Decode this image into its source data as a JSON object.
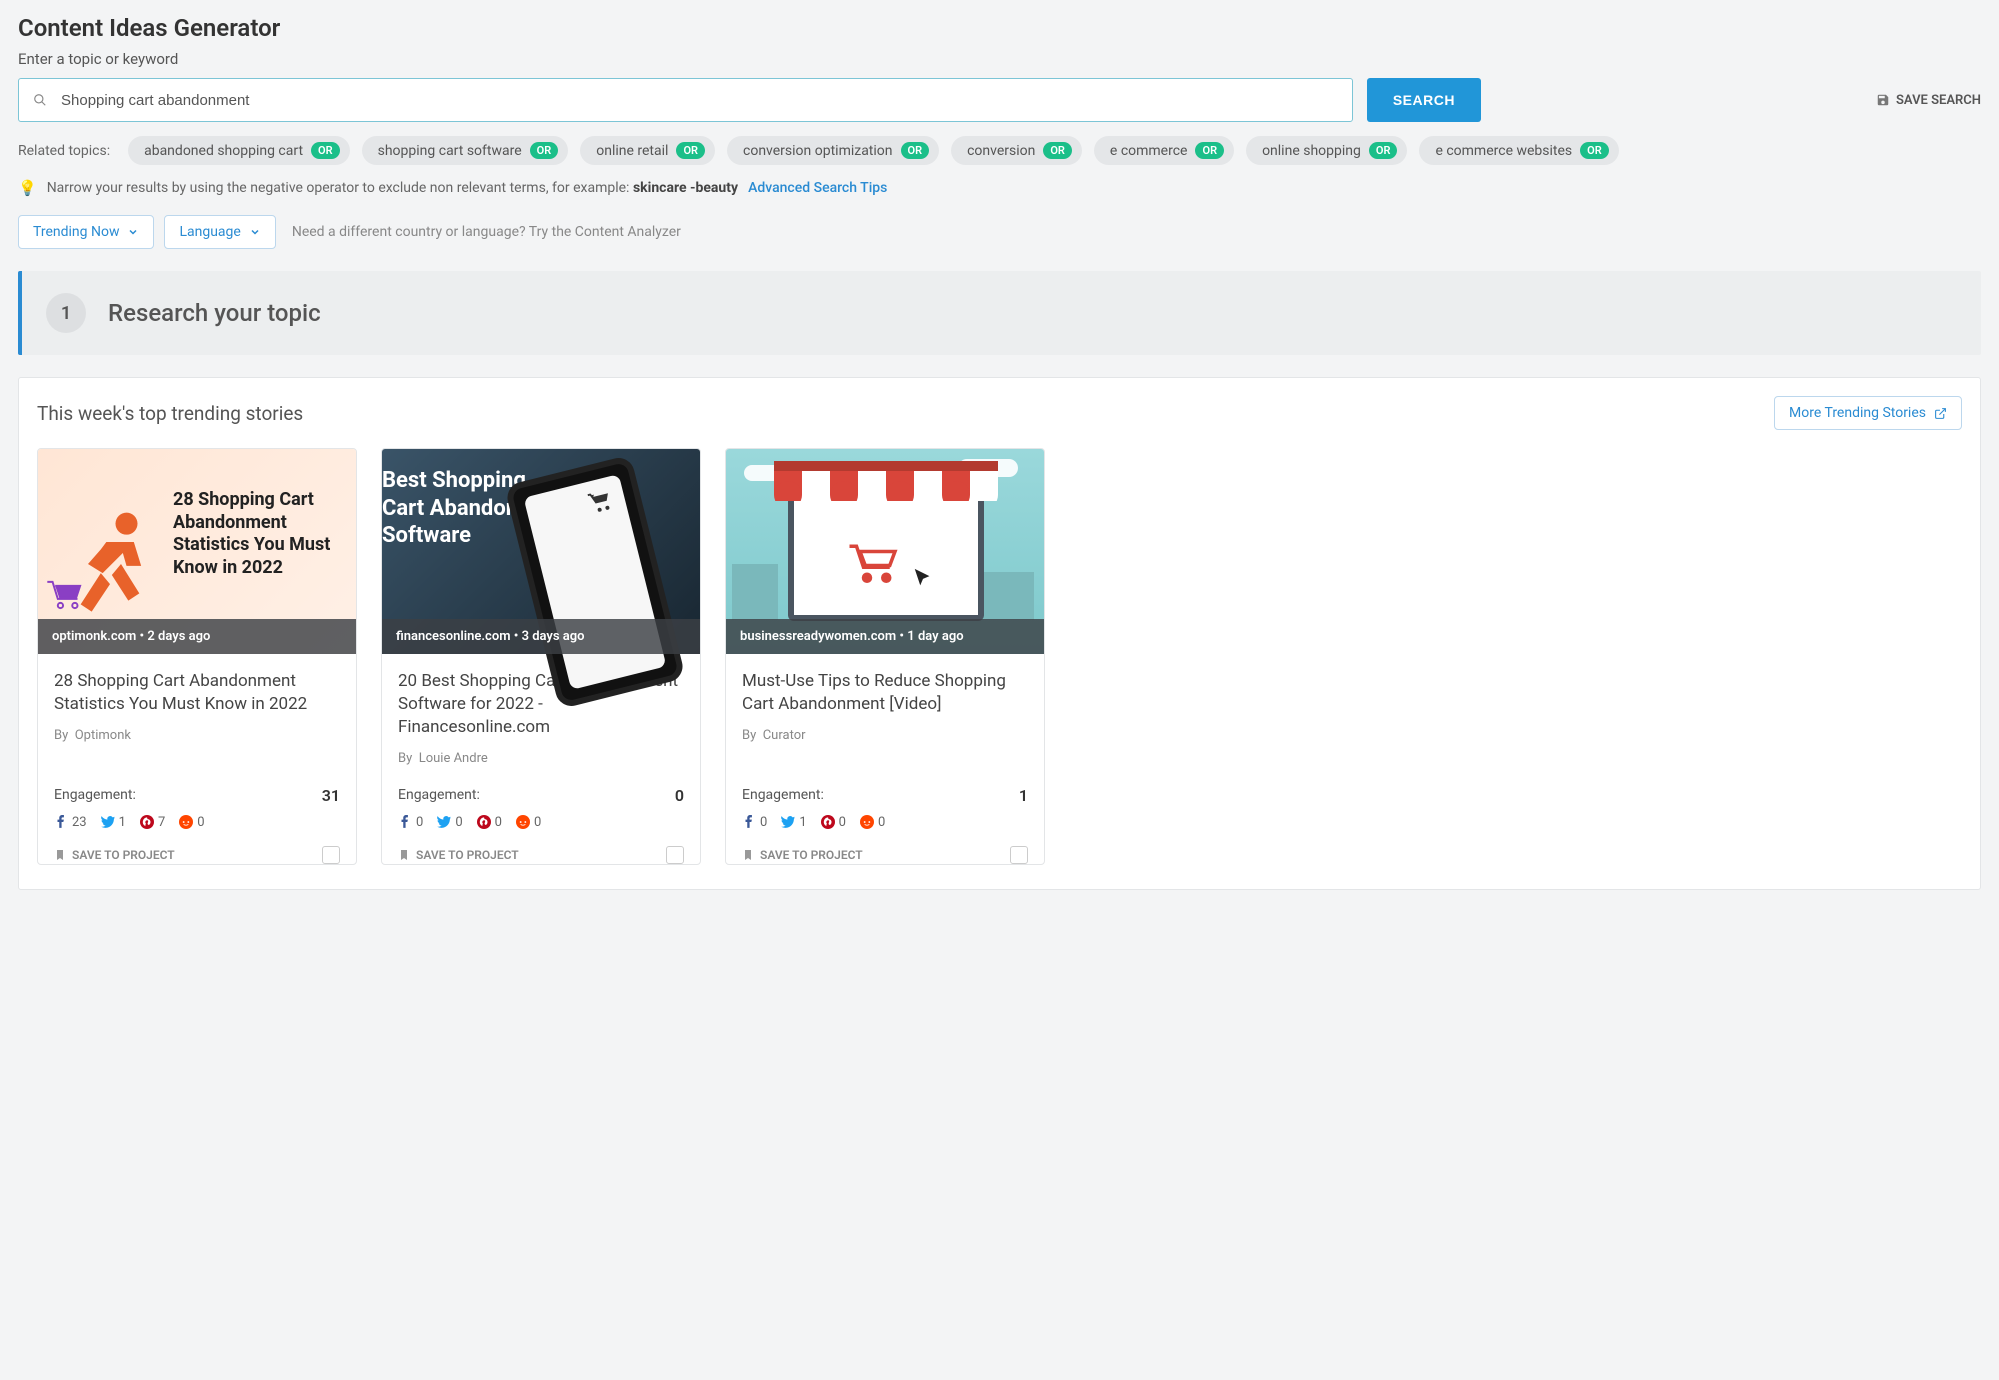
{
  "header": {
    "title": "Content Ideas Generator",
    "subtitle": "Enter a topic or keyword",
    "search_value": "Shopping cart abandonment",
    "search_button": "SEARCH",
    "save_search": "SAVE SEARCH"
  },
  "related": {
    "label": "Related topics:",
    "or": "OR",
    "items": [
      "abandoned shopping cart",
      "shopping cart software",
      "online retail",
      "conversion optimization",
      "conversion",
      "e commerce",
      "online shopping",
      "e commerce websites"
    ]
  },
  "tip": {
    "text": "Narrow your results by using the negative operator to exclude non relevant terms, for example: ",
    "example": "skincare -beauty",
    "link": "Advanced Search Tips"
  },
  "filters": {
    "trending": "Trending Now",
    "language": "Language",
    "hint": "Need a different country or language? Try the Content Analyzer"
  },
  "section": {
    "num": "1",
    "title": "Research your topic"
  },
  "trending": {
    "title": "This week's top trending stories",
    "more": "More Trending Stories"
  },
  "labels": {
    "engagement": "Engagement:",
    "by": "By",
    "save_project": "SAVE TO PROJECT"
  },
  "cards": [
    {
      "overlay_text": "28 Shopping Cart Abandonment Statistics You Must Know in 2022",
      "source": "optimonk.com",
      "age": "2 days ago",
      "title": "28 Shopping Cart Abandonment Statistics You Must Know in 2022",
      "author": "Optimonk",
      "engagement": "31",
      "social": {
        "fb": "23",
        "tw": "1",
        "pn": "7",
        "rd": "0"
      }
    },
    {
      "overlay_text": "Best Shopping Cart Abandonment Software",
      "source": "financesonline.com",
      "age": "3 days ago",
      "title": "20 Best Shopping Cart Abandonment Software for 2022 - Financesonline.com",
      "author": "Louie Andre",
      "engagement": "0",
      "social": {
        "fb": "0",
        "tw": "0",
        "pn": "0",
        "rd": "0"
      }
    },
    {
      "overlay_text": "",
      "source": "businessreadywomen.com",
      "age": "1 day ago",
      "title": "Must-Use Tips to Reduce Shopping Cart Abandonment [Video]",
      "author": "Curator",
      "engagement": "1",
      "social": {
        "fb": "0",
        "tw": "1",
        "pn": "0",
        "rd": "0"
      }
    }
  ]
}
